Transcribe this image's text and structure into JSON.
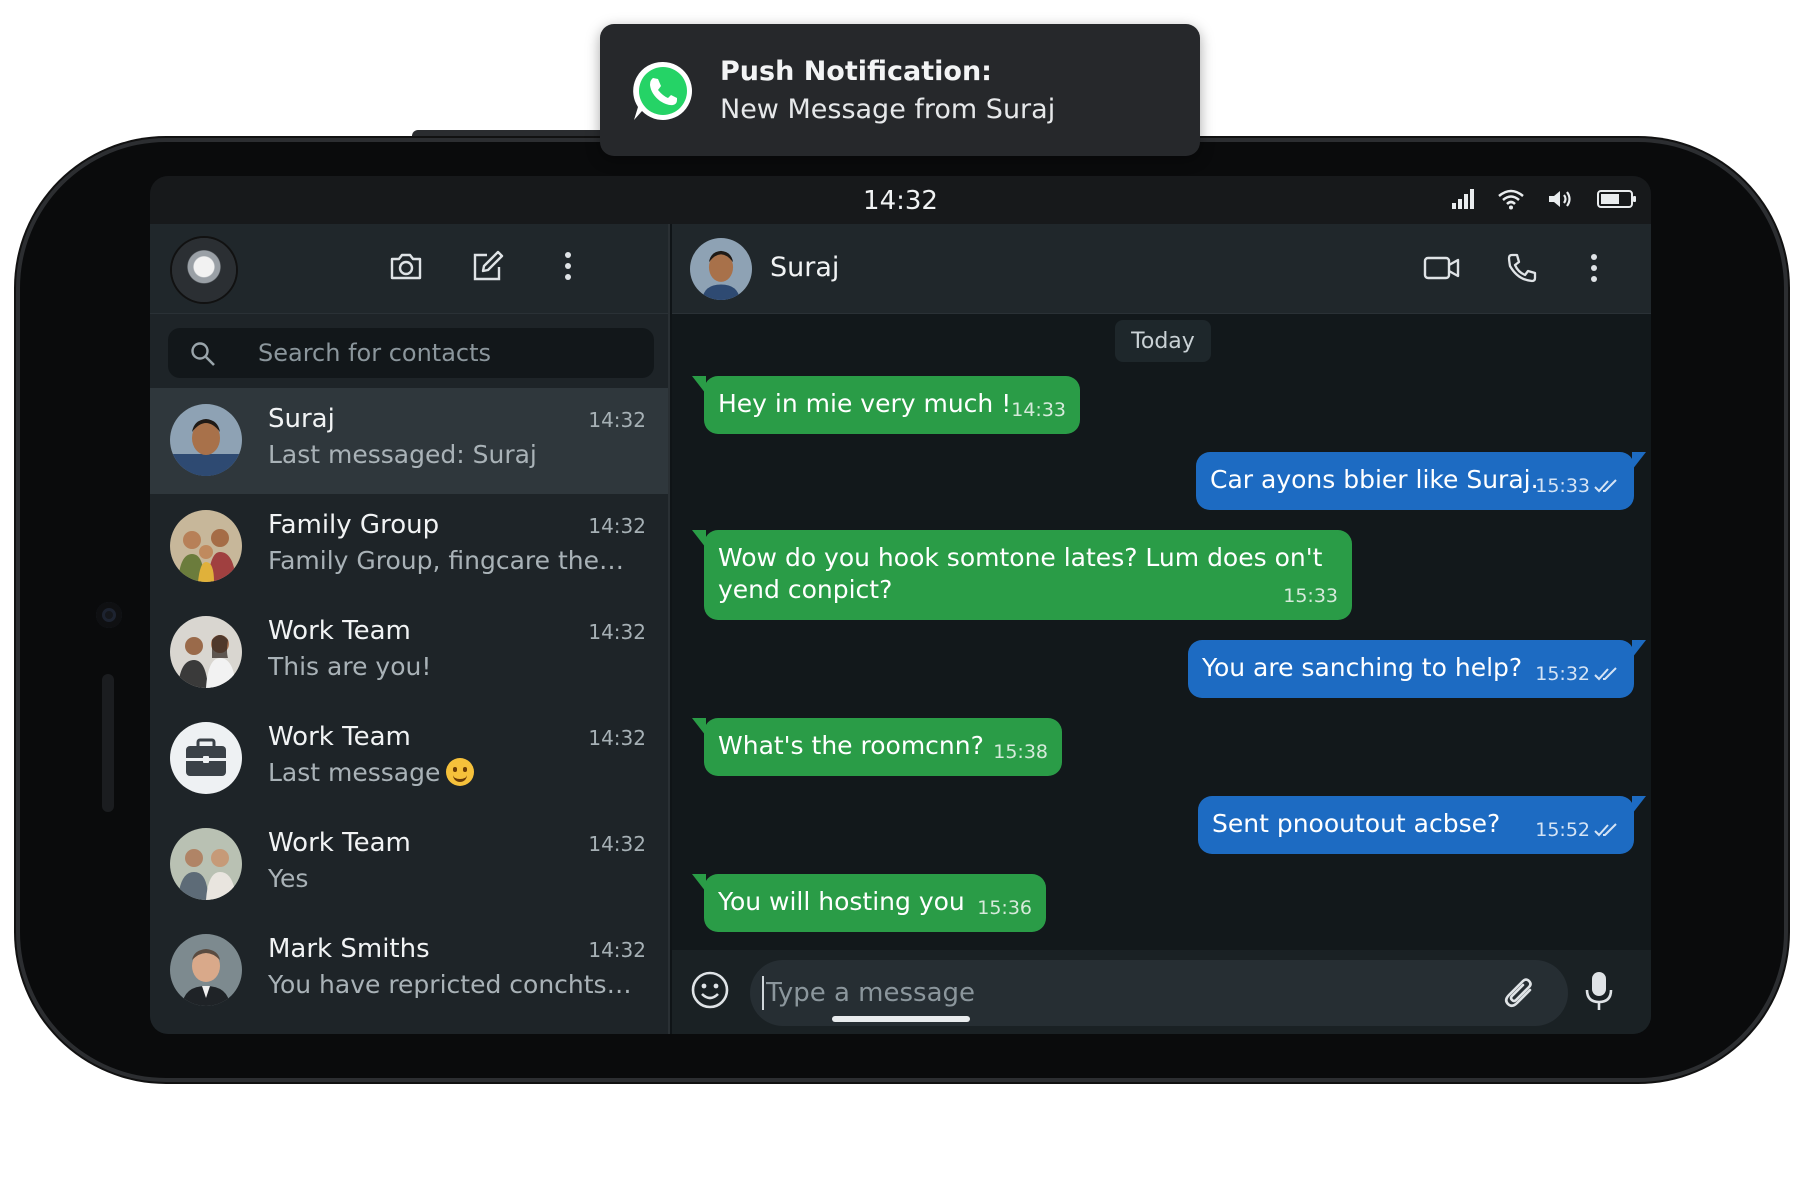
{
  "notification": {
    "app_icon": "whatsapp-icon",
    "title": "Push Notification:",
    "body": "New Message from Suraj"
  },
  "status_bar": {
    "time": "14:32",
    "icons": [
      "signal-icon",
      "wifi-icon",
      "volume-icon",
      "battery-icon"
    ]
  },
  "left_header": {
    "buttons": [
      "camera-icon",
      "compose-icon",
      "more-vert-icon"
    ]
  },
  "search": {
    "placeholder": "Search for contacts"
  },
  "chats": [
    {
      "name": "Suraj",
      "time": "14:32",
      "preview": "Last messaged: Suraj",
      "active": true
    },
    {
      "name": "Family Group",
      "time": "14:32",
      "preview": "Family Group, fingcare the…",
      "active": false
    },
    {
      "name": "Work Team",
      "time": "14:32",
      "preview": "This are you!",
      "active": false
    },
    {
      "name": "Work Team",
      "time": "14:32",
      "preview": "Last message",
      "preview_emoji": "smile-emoji",
      "active": false
    },
    {
      "name": "Work Team",
      "time": "14:32",
      "preview": "Yes",
      "active": false
    },
    {
      "name": "Mark Smiths",
      "time": "14:32",
      "preview": "You have repricted conchts, …",
      "active": false
    }
  ],
  "conversation": {
    "contact_name": "Suraj",
    "header_buttons": [
      "video-call-icon",
      "phone-icon",
      "more-vert-icon"
    ],
    "date_label": "Today",
    "messages": [
      {
        "direction": "in",
        "text": "Hey in mie very much !",
        "time": "14:33"
      },
      {
        "direction": "out",
        "text": "Car ayons bbier like Suraj.",
        "time": "15:33",
        "read": true
      },
      {
        "direction": "in",
        "text": "Wow do you hook somtone lates? Lum does on't yend conpict?",
        "time": "15:33"
      },
      {
        "direction": "out",
        "text": "You are sanching to help?",
        "time": "15:32",
        "read": true
      },
      {
        "direction": "in",
        "text": "What's the roomcnn?",
        "time": "15:38"
      },
      {
        "direction": "out",
        "text": "Sent pnooutout acbse?",
        "time": "15:52",
        "read": true
      },
      {
        "direction": "in",
        "text": "You will hosting you",
        "time": "15:36"
      }
    ]
  },
  "composer": {
    "placeholder": "Type a message",
    "buttons": [
      "emoji-icon",
      "attach-icon",
      "mic-icon"
    ]
  },
  "colors": {
    "incoming_bubble": "#2a9c47",
    "outgoing_bubble": "#1d6bc2",
    "background": "#12181b",
    "panel": "#1e2428"
  }
}
